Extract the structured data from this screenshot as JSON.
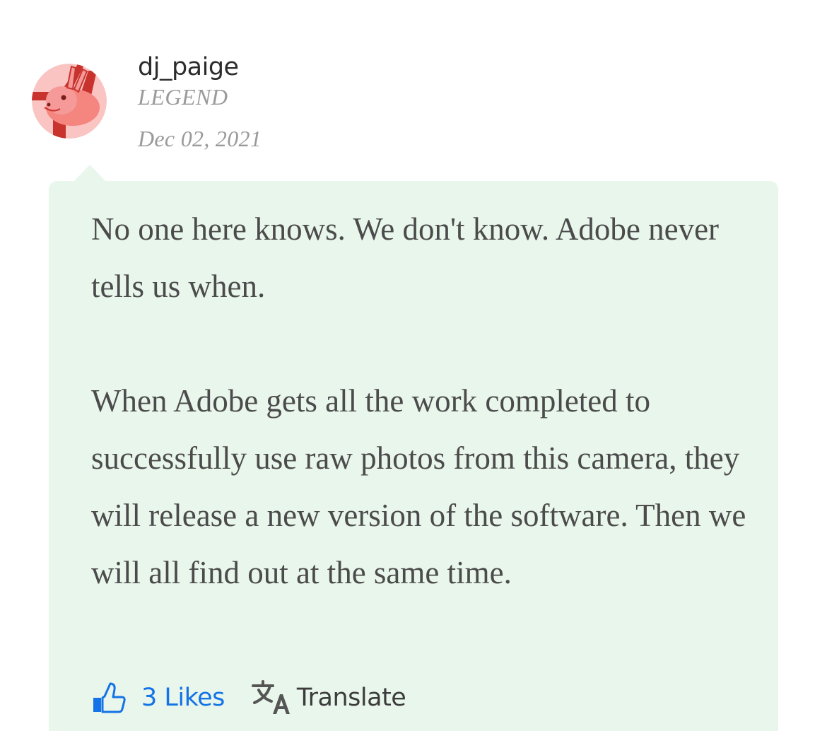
{
  "post": {
    "author": {
      "username": "dj_paige",
      "rank": "LEGEND",
      "avatar_icon": "rabbit-avatar"
    },
    "date": "Dec 02, 2021",
    "body": [
      "No one here knows. We don't know. Adobe never tells us when.",
      "When Adobe gets all the work completed to successfully use raw photos from this camera, they will release a new version of the software. Then we will all find out at the same time."
    ],
    "actions": {
      "likes_label": "3 Likes",
      "translate_label": "Translate"
    }
  },
  "colors": {
    "bubble_background": "#e9f6ec",
    "link_blue": "#1473e6",
    "meta_gray": "#9a9a9a",
    "avatar_pink": "#f59a98",
    "avatar_red": "#c8332e"
  }
}
